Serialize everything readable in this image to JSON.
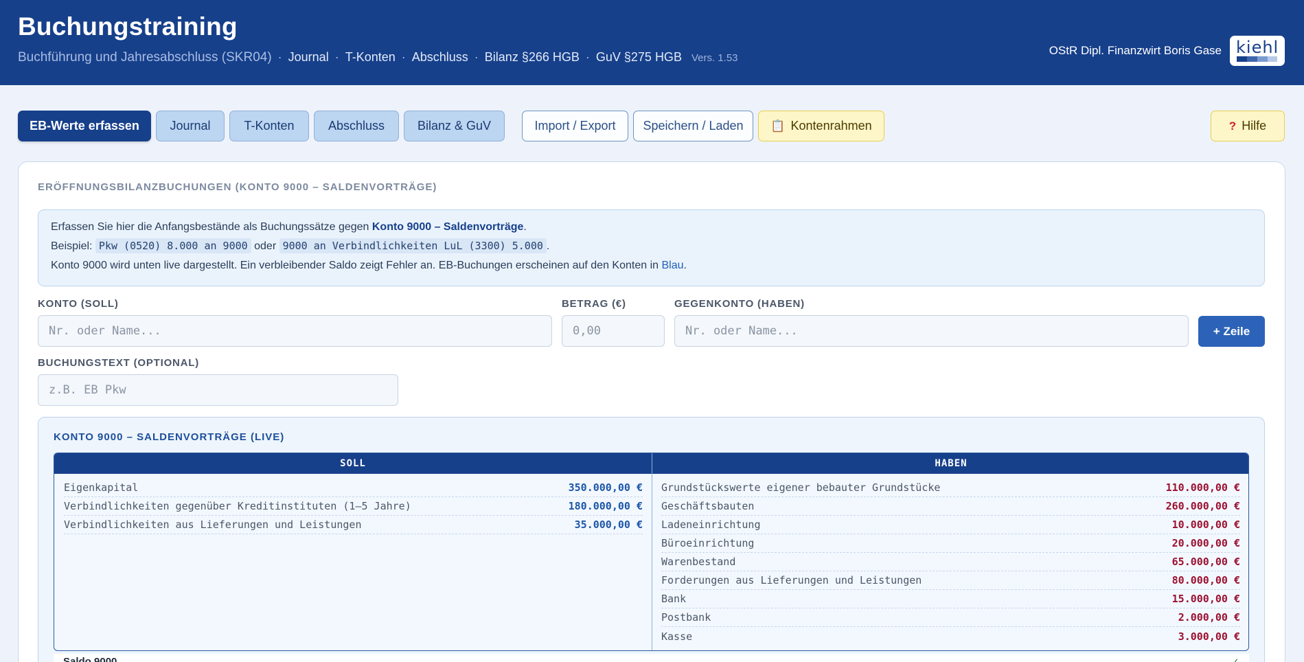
{
  "header": {
    "title": "Buchungstraining",
    "subtitle": "Buchführung und Jahresabschluss (SKR04)",
    "crumbs": [
      "Journal",
      "T-Konten",
      "Abschluss",
      "Bilanz §266 HGB",
      "GuV §275 HGB"
    ],
    "version": "Vers. 1.53",
    "author": "OStR Dipl. Finanzwirt Boris Gase",
    "logo_text": "kiehl",
    "colors": {
      "header_bg": "#17408b",
      "accent": "#2c63b8"
    }
  },
  "toolbar": {
    "tabs": [
      "EB-Werte erfassen",
      "Journal",
      "T-Konten",
      "Abschluss",
      "Bilanz & GuV"
    ],
    "import_export": "Import / Export",
    "save_load": "Speichern / Laden",
    "chart_of_accounts": "Kontenrahmen",
    "help": "Hilfe"
  },
  "section": {
    "title": "ERÖFFNUNGSBILANZBUCHUNGEN (KONTO 9000 – SALDENVORTRÄGE)"
  },
  "info": {
    "l1_pre": "Erfassen Sie hier die Anfangsbestände als Buchungssätze gegen ",
    "l1_bold": "Konto 9000 – Saldenvorträge",
    "l1_post": ".",
    "l2_pre": "Beispiel: ",
    "l2_code1": "Pkw (0520) 8.000 an 9000",
    "l2_mid": " oder ",
    "l2_code2": "9000 an Verbindlichkeiten LuL (3300) 5.000",
    "l2_post": ".",
    "l3_pre": "Konto 9000 wird unten live dargestellt. Ein verbleibender Saldo zeigt Fehler an. EB-Buchungen erscheinen auf den Konten in ",
    "l3_blue": "Blau",
    "l3_post": "."
  },
  "form": {
    "konto_label": "KONTO (SOLL)",
    "konto_placeholder": "Nr. oder Name...",
    "betrag_label": "BETRAG (€)",
    "betrag_placeholder": "0,00",
    "gegenkonto_label": "GEGENKONTO (HABEN)",
    "gegenkonto_placeholder": "Nr. oder Name...",
    "add_row": "+ Zeile",
    "text_label": "BUCHUNGSTEXT (OPTIONAL)",
    "text_placeholder": "z.B. EB Pkw"
  },
  "live": {
    "title": "KONTO 9000 – SALDENVORTRÄGE (LIVE)",
    "soll_header": "SOLL",
    "haben_header": "HABEN",
    "soll": [
      {
        "name": "Eigenkapital",
        "amount": "350.000,00 €"
      },
      {
        "name": "Verbindlichkeiten gegenüber Kreditinstituten (1–5 Jahre)",
        "amount": "180.000,00 €"
      },
      {
        "name": "Verbindlichkeiten aus Lieferungen und Leistungen",
        "amount": "35.000,00 €"
      }
    ],
    "haben": [
      {
        "name": "Grundstückswerte eigener bebauter Grundstücke",
        "amount": "110.000,00 €"
      },
      {
        "name": "Geschäftsbauten",
        "amount": "260.000,00 €"
      },
      {
        "name": "Ladeneinrichtung",
        "amount": "10.000,00 €"
      },
      {
        "name": "Büroeinrichtung",
        "amount": "20.000,00 €"
      },
      {
        "name": "Warenbestand",
        "amount": "65.000,00 €"
      },
      {
        "name": "Forderungen aus Lieferungen und Leistungen",
        "amount": "80.000,00 €"
      },
      {
        "name": "Bank",
        "amount": "15.000,00 €"
      },
      {
        "name": "Postbank",
        "amount": "2.000,00 €"
      },
      {
        "name": "Kasse",
        "amount": "3.000,00 €"
      }
    ],
    "saldo_label": "Saldo 9000",
    "saldo_status": "✓"
  }
}
